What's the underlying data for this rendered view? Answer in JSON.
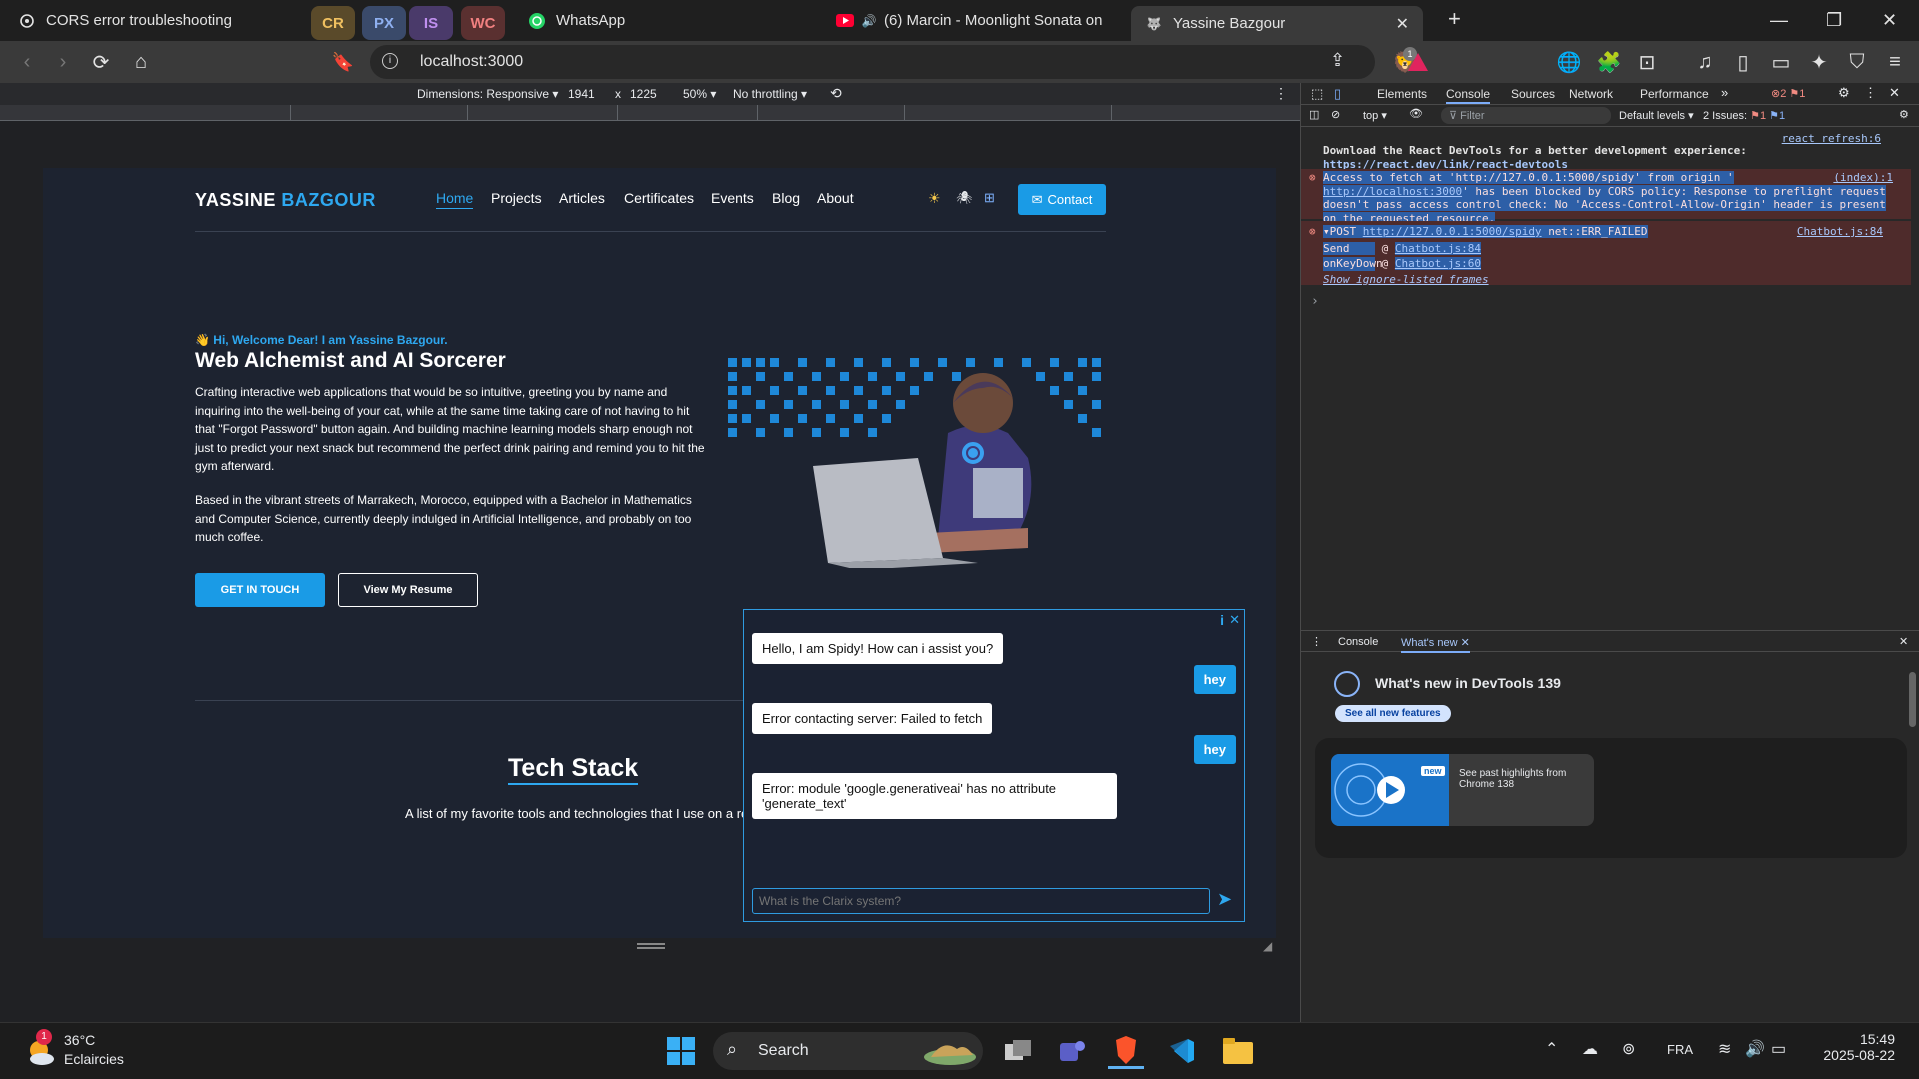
{
  "tabs": {
    "first": "CORS error troubleshooting",
    "pinned": [
      "CR",
      "PX",
      "IS",
      "WC"
    ],
    "whatsapp": "WhatsApp",
    "youtube": "(6) Marcin - Moonlight Sonata on",
    "active": "Yassine Bazgour"
  },
  "colors": {
    "pinned_bg": [
      "#5a4a2a",
      "#3a4a6a",
      "#4a3a6a",
      "#5a3030"
    ],
    "pinned_fg": [
      "#f0c060",
      "#8fb0f0",
      "#c090f0",
      "#f08080"
    ]
  },
  "address": {
    "url": "localhost:3000"
  },
  "device_toolbar": {
    "dimensions_label": "Dimensions: Responsive",
    "width": "1941",
    "times": "x",
    "height": "1225",
    "zoom": "50%",
    "throttle": "No throttling"
  },
  "site": {
    "logo_first": "YASSINE",
    "logo_second": "BAZGOUR",
    "nav": [
      "Home",
      "Projects",
      "Articles",
      "Certificates",
      "Events",
      "Blog",
      "About"
    ],
    "contact": "Contact",
    "greeting": "👋 Hi, Welcome Dear! I am Yassine Bazgour.",
    "headline": "Web Alchemist and AI Sorcerer",
    "para1": "Crafting interactive web applications that would be so intuitive, greeting you by name and inquiring into the well-being of your cat, while at the same time taking care of not having to hit that \"Forgot Password\" button again. And building machine learning models sharp enough not just to predict your next snack but recommend the perfect drink pairing and remind you to hit the gym afterward.",
    "para2": "Based in the vibrant streets of Marrakech, Morocco, equipped with a Bachelor in Mathematics and Computer Science, currently deeply indulged in Artificial Intelligence, and probably on too much coffee.",
    "btn_touch": "GET IN TOUCH",
    "btn_resume": "View My Resume",
    "tech_title": "Tech Stack",
    "tech_sub": "A list of my favorite tools and technologies that I use on a regular basis"
  },
  "chat": {
    "messages": [
      {
        "from": "bot",
        "text": "Hello, I am Spidy! How can i assist you?"
      },
      {
        "from": "user",
        "text": "hey"
      },
      {
        "from": "bot",
        "text": "Error contacting server: Failed to fetch"
      },
      {
        "from": "user",
        "text": "hey"
      },
      {
        "from": "bot",
        "text": "Error: module 'google.generativeai' has no attribute 'generate_text'"
      }
    ],
    "placeholder": "What is the Clarix system?",
    "info": "i",
    "close": "✕"
  },
  "devtools": {
    "tabs": [
      "Elements",
      "Console",
      "Sources",
      "Network",
      "Performance"
    ],
    "errors_count": "2",
    "warnings_count": "1",
    "context": "top",
    "filter_placeholder": "Filter",
    "levels": "Default levels",
    "issues_label": "2 Issues:",
    "issues_err": "1",
    "issues_info": "1",
    "lines": {
      "react_refresh": "react refresh:6",
      "devtools_msg": "Download the React DevTools for a better development experience:",
      "devtools_link": "https://react.dev/link/react-devtools",
      "cors_source": "(index):1",
      "cors_1": "Access to fetch at 'http://127.0.0.1:5000/spidy' from origin '",
      "cors_2_link": "http://localhost:3000",
      "cors_2_rest": "' has been blocked by CORS policy: Response to preflight request",
      "cors_3": "doesn't pass access control check: No 'Access-Control-Allow-Origin' header is present",
      "cors_4": "on the requested resource.",
      "post_prefix": "POST",
      "post_link": "http://127.0.0.1:5000/spidy",
      "post_status": "net::ERR_FAILED",
      "post_source": "Chatbot.js:84",
      "stack1_fn": "Send",
      "stack1_src": "Chatbot.js:84",
      "stack2_fn": "onKeyDown",
      "stack2_src": "Chatbot.js:60",
      "ignore": "Show ignore-listed frames",
      "prompt": "›"
    },
    "drawer_tabs": [
      "Console",
      "What's new"
    ],
    "whats_new_title": "What's new in DevTools 139",
    "see_all": "See all new features",
    "new_badge": "new",
    "highlights": "See past highlights from Chrome 138"
  },
  "taskbar": {
    "weather_temp": "36°C",
    "weather_desc": "Eclaircies",
    "weather_badge": "1",
    "search": "Search",
    "lang": "FRA",
    "time": "15:49",
    "date": "2025-08-22"
  }
}
